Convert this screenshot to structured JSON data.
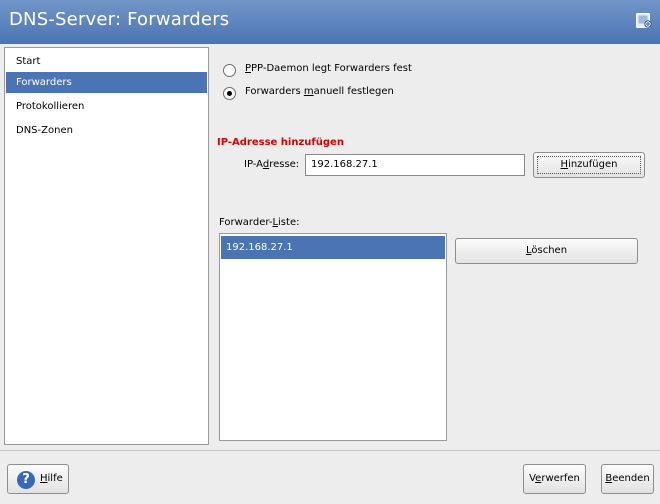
{
  "window": {
    "title": "DNS-Server: Forwarders",
    "accent": "#4a74b3"
  },
  "sidebar": {
    "items": [
      {
        "label": "Start"
      },
      {
        "label": "Forwarders",
        "selected": true
      },
      {
        "label": "Protokollieren"
      },
      {
        "label": "DNS-Zonen"
      }
    ]
  },
  "options": {
    "ppp": {
      "mnemonic": "P",
      "rest": "PP-Daemon legt Forwarders fest",
      "checked": false
    },
    "manual": {
      "pre": "Forwarders ",
      "mnemonic": "m",
      "rest": "anuell festlegen",
      "checked": true
    }
  },
  "add_section": {
    "title": "IP-Adresse hinzufügen",
    "label_pre": "IP-A",
    "label_mnemonic": "d",
    "label_rest": "resse:",
    "value": "192.168.27.1",
    "button": {
      "mnemonic": "H",
      "rest": "inzufügen"
    }
  },
  "forwarder_list": {
    "label_pre": "Forwarder-",
    "label_mnemonic": "L",
    "label_rest": "iste:",
    "items": [
      "192.168.27.1"
    ],
    "delete_button": {
      "mnemonic": "L",
      "rest": "öschen"
    }
  },
  "footer": {
    "help": {
      "mnemonic": "H",
      "rest": "ilfe",
      "icon": "help-icon"
    },
    "discard": {
      "pre": "V",
      "mnemonic": "e",
      "rest": "rwerfen"
    },
    "finish": {
      "mnemonic": "B",
      "rest": "eenden"
    }
  }
}
